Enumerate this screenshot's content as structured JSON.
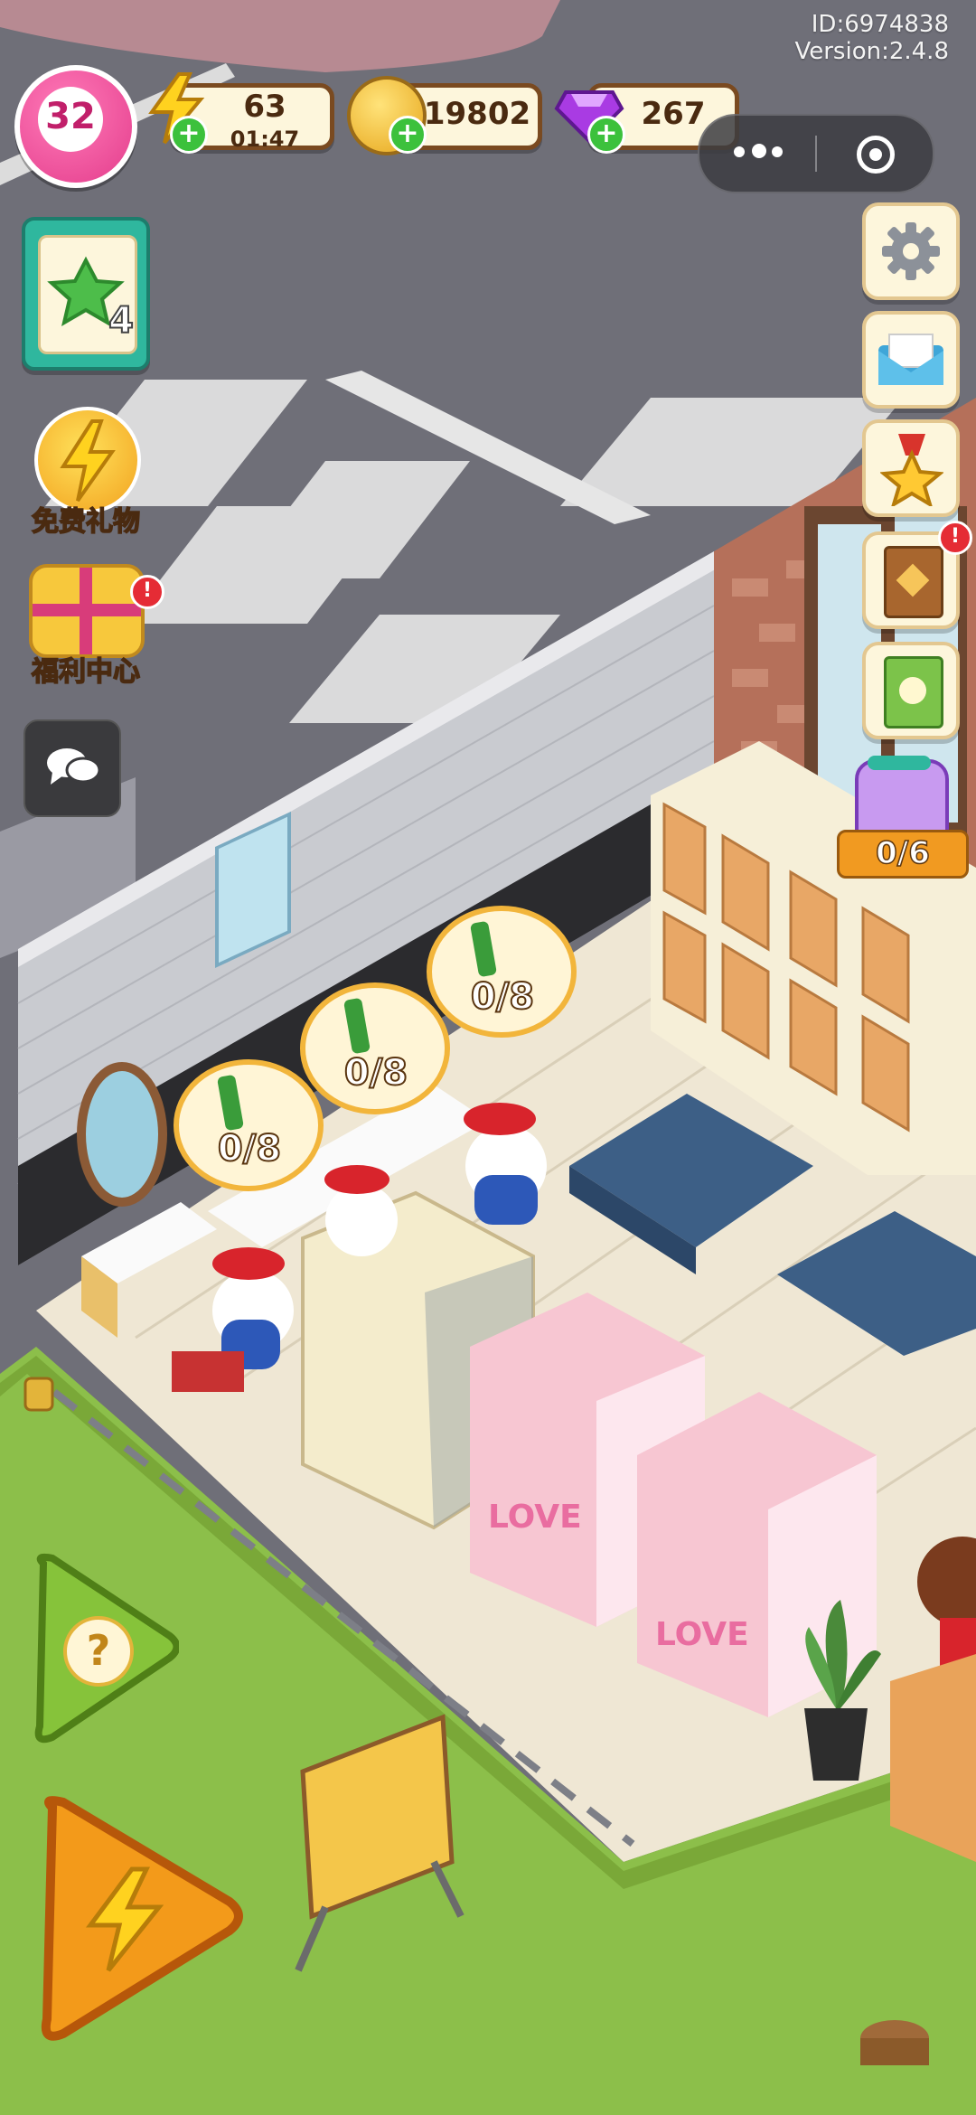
{
  "account": {
    "id": "ID:6974838",
    "version": "Version:2.4.8"
  },
  "hud": {
    "level": "32",
    "energy": {
      "value": "63",
      "timer": "01:47"
    },
    "coins": "19802",
    "gems": "267"
  },
  "left_menu": {
    "task_badge": "4",
    "free_gift_label": "免费礼物",
    "welfare_label": "福利中心"
  },
  "right_menu": {
    "jar_progress": "0/6"
  },
  "bubbles": [
    {
      "progress": "0/8"
    },
    {
      "progress": "0/8"
    },
    {
      "progress": "0/8"
    }
  ],
  "icons": {
    "level": "heart-level-icon",
    "energy": "lightning-icon",
    "coin": "coin-icon",
    "gem": "gem-icon",
    "settings": "gear-icon",
    "mail": "mail-icon",
    "achievement": "star-medal-icon",
    "book": "heart-book-icon",
    "guide": "green-book-icon",
    "chat": "chat-icon",
    "help": "question-icon",
    "boost": "lightning-icon"
  },
  "colors": {
    "grass": "#8cbf4a",
    "road": "#6f6f78",
    "accent_pink": "#e43d8c",
    "hud_border": "#7a4a20"
  }
}
